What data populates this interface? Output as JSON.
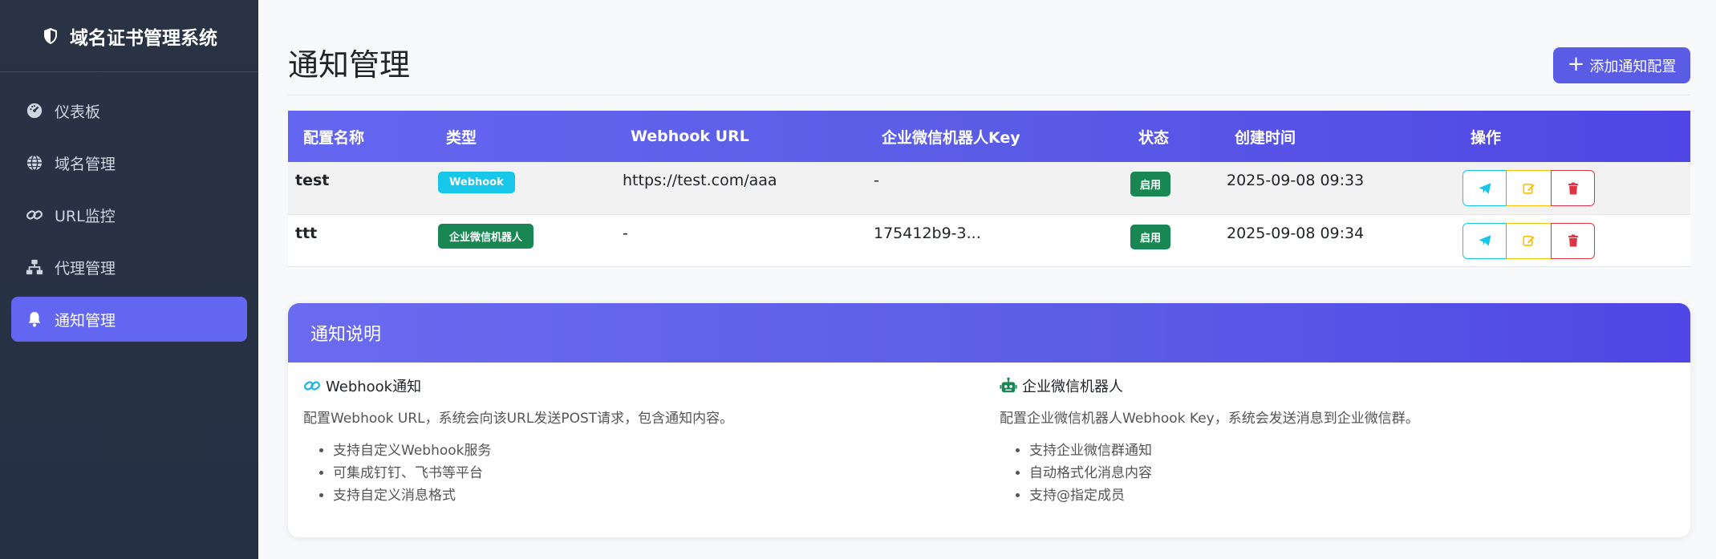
{
  "sidebar": {
    "brand": "域名证书管理系统",
    "items": [
      {
        "label": "仪表板",
        "icon": "gauge-icon"
      },
      {
        "label": "域名管理",
        "icon": "globe-icon"
      },
      {
        "label": "URL监控",
        "icon": "link-icon"
      },
      {
        "label": "代理管理",
        "icon": "sitemap-icon"
      },
      {
        "label": "通知管理",
        "icon": "bell-icon",
        "active": true
      }
    ]
  },
  "header": {
    "title": "通知管理",
    "add_label": "添加通知配置"
  },
  "table": {
    "columns": [
      "配置名称",
      "类型",
      "Webhook URL",
      "企业微信机器人Key",
      "状态",
      "创建时间",
      "操作"
    ],
    "rows": [
      {
        "name": "test",
        "type": "Webhook",
        "url": "https://test.com/aaa",
        "key": "-",
        "status": "启用",
        "created": "2025-09-08 09:33"
      },
      {
        "name": "ttt",
        "type": "企业微信机器人",
        "url": "-",
        "key": "175412b9-3...",
        "status": "启用",
        "created": "2025-09-08 09:34"
      }
    ]
  },
  "info": {
    "title": "通知说明",
    "webhook": {
      "heading": "Webhook通知",
      "desc": "配置Webhook URL，系统会向该URL发送POST请求，包含通知内容。",
      "points": [
        "支持自定义Webhook服务",
        "可集成钉钉、飞书等平台",
        "支持自定义消息格式"
      ]
    },
    "wecom": {
      "heading": "企业微信机器人",
      "desc": "配置企业微信机器人Webhook Key，系统会发送消息到企业微信群。",
      "points": [
        "支持企业微信群通知",
        "自动格式化消息内容",
        "支持@指定成员"
      ]
    }
  },
  "colors": {
    "accent": "#6366f1",
    "sidebar_bg": "#2a3344",
    "info": "#17c6e9",
    "success": "#198754",
    "warning": "#ffc107",
    "danger": "#dc3545"
  }
}
